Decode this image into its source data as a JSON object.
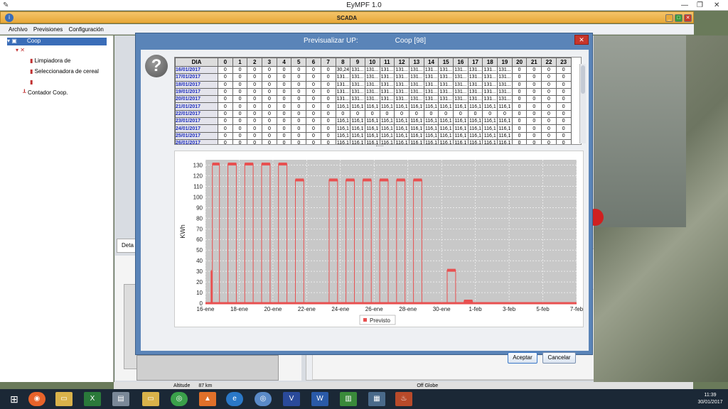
{
  "outer": {
    "app_title": "EyMPF 1.0"
  },
  "scada": {
    "title": "SCADA"
  },
  "menu": [
    "Archivo",
    "Previsiones",
    "Configuración"
  ],
  "tree": {
    "root": "Coop",
    "items": [
      "Limpiadora de",
      "Seleccionadora de cereal",
      "Contador Coop."
    ]
  },
  "lower_tab": "Deta",
  "status": {
    "altitude": "Altitude",
    "km": "87 km",
    "globe": "Off Globe"
  },
  "dialog": {
    "title": "Previsualizar UP:",
    "title_suffix": "Coop [98]",
    "accept": "Aceptar",
    "cancel": "Cancelar",
    "table": {
      "headers": [
        "DIA",
        "0",
        "1",
        "2",
        "3",
        "4",
        "5",
        "6",
        "7",
        "8",
        "9",
        "10",
        "11",
        "12",
        "13",
        "14",
        "15",
        "16",
        "17",
        "18",
        "19",
        "20",
        "21",
        "22",
        "23"
      ],
      "rows": [
        [
          "16/01/2017",
          "0",
          "0",
          "0",
          "0",
          "0",
          "0",
          "0",
          "0",
          "30,24",
          "131...",
          "131...",
          "131...",
          "131...",
          "131...",
          "131...",
          "131...",
          "131...",
          "131...",
          "131...",
          "131...",
          "0",
          "0",
          "0",
          "0"
        ],
        [
          "17/01/2017",
          "0",
          "0",
          "0",
          "0",
          "0",
          "0",
          "0",
          "0",
          "131...",
          "131...",
          "131...",
          "131...",
          "131...",
          "131...",
          "131...",
          "131...",
          "131...",
          "131...",
          "131...",
          "131...",
          "0",
          "0",
          "0",
          "0"
        ],
        [
          "18/01/2017",
          "0",
          "0",
          "0",
          "0",
          "0",
          "0",
          "0",
          "0",
          "131...",
          "131...",
          "131...",
          "131...",
          "131...",
          "131...",
          "131...",
          "131...",
          "131...",
          "131...",
          "131...",
          "131...",
          "0",
          "0",
          "0",
          "0"
        ],
        [
          "19/01/2017",
          "0",
          "0",
          "0",
          "0",
          "0",
          "0",
          "0",
          "0",
          "131...",
          "131...",
          "131...",
          "131...",
          "131...",
          "131...",
          "131...",
          "131...",
          "131...",
          "131...",
          "131...",
          "131...",
          "0",
          "0",
          "0",
          "0"
        ],
        [
          "20/01/2017",
          "0",
          "0",
          "0",
          "0",
          "0",
          "0",
          "0",
          "0",
          "131...",
          "131...",
          "131...",
          "131...",
          "131...",
          "131...",
          "131...",
          "131...",
          "131...",
          "131...",
          "131...",
          "131...",
          "0",
          "0",
          "0",
          "0"
        ],
        [
          "21/01/2017",
          "0",
          "0",
          "0",
          "0",
          "0",
          "0",
          "0",
          "0",
          "116,1",
          "116,1",
          "116,1",
          "116,1",
          "116,1",
          "116,1",
          "116,1",
          "116,1",
          "116,1",
          "116,1",
          "116,1",
          "116,1",
          "0",
          "0",
          "0",
          "0"
        ],
        [
          "22/01/2017",
          "0",
          "0",
          "0",
          "0",
          "0",
          "0",
          "0",
          "0",
          "0",
          "0",
          "0",
          "0",
          "0",
          "0",
          "0",
          "0",
          "0",
          "0",
          "0",
          "0",
          "0",
          "0",
          "0",
          "0"
        ],
        [
          "23/01/2017",
          "0",
          "0",
          "0",
          "0",
          "0",
          "0",
          "0",
          "0",
          "116,1",
          "116,1",
          "116,1",
          "116,1",
          "116,1",
          "116,1",
          "116,1",
          "116,1",
          "116,1",
          "116,1",
          "116,1",
          "116,1",
          "0",
          "0",
          "0",
          "0"
        ],
        [
          "24/01/2017",
          "0",
          "0",
          "0",
          "0",
          "0",
          "0",
          "0",
          "0",
          "116,1",
          "116,1",
          "116,1",
          "116,1",
          "116,1",
          "116,1",
          "116,1",
          "116,1",
          "116,1",
          "116,1",
          "116,1",
          "116,1",
          "0",
          "0",
          "0",
          "0"
        ],
        [
          "25/01/2017",
          "0",
          "0",
          "0",
          "0",
          "0",
          "0",
          "0",
          "0",
          "116,1",
          "116,1",
          "116,1",
          "116,1",
          "116,1",
          "116,1",
          "116,1",
          "116,1",
          "116,1",
          "116,1",
          "116,1",
          "116,1",
          "0",
          "0",
          "0",
          "0"
        ],
        [
          "26/01/2017",
          "0",
          "0",
          "0",
          "0",
          "0",
          "0",
          "0",
          "0",
          "116,1",
          "116,1",
          "116,1",
          "116,1",
          "116,1",
          "116,1",
          "116,1",
          "116,1",
          "116,1",
          "116,1",
          "116,1",
          "116,1",
          "0",
          "0",
          "0",
          "0"
        ]
      ]
    }
  },
  "taskbar": {
    "time": "11:39",
    "date": "30/01/2017"
  },
  "colors": {
    "series": "#e85050",
    "plot_bg": "#c8c8c8",
    "dialog": "#5a84b8"
  },
  "chart_data": {
    "type": "line",
    "ylabel": "KWh",
    "ylim": [
      0,
      135
    ],
    "yticks": [
      0,
      10,
      20,
      30,
      40,
      50,
      60,
      70,
      80,
      90,
      100,
      110,
      120,
      130
    ],
    "xlim": [
      0,
      22
    ],
    "xticks": [
      {
        "v": 0,
        "label": "16-ene"
      },
      {
        "v": 2,
        "label": "18-ene"
      },
      {
        "v": 4,
        "label": "20-ene"
      },
      {
        "v": 6,
        "label": "22-ene"
      },
      {
        "v": 8,
        "label": "24-ene"
      },
      {
        "v": 10,
        "label": "26-ene"
      },
      {
        "v": 12,
        "label": "28-ene"
      },
      {
        "v": 14,
        "label": "30-ene"
      },
      {
        "v": 16,
        "label": "1-feb"
      },
      {
        "v": 18,
        "label": "3-feb"
      },
      {
        "v": 20,
        "label": "5-feb"
      },
      {
        "v": 22,
        "label": "7-feb"
      }
    ],
    "grid": true,
    "legend": "bottom",
    "series": [
      {
        "name": "Previsto",
        "days": [
          {
            "start": "16-ene",
            "x0": 0.33,
            "x1": 0.83,
            "value": 131,
            "first": 30
          },
          {
            "start": "17-ene",
            "x0": 1.33,
            "x1": 1.83,
            "value": 131
          },
          {
            "start": "18-ene",
            "x0": 2.33,
            "x1": 2.83,
            "value": 131
          },
          {
            "start": "19-ene",
            "x0": 3.33,
            "x1": 3.83,
            "value": 131
          },
          {
            "start": "20-ene",
            "x0": 4.33,
            "x1": 4.83,
            "value": 131
          },
          {
            "start": "21-ene",
            "x0": 5.33,
            "x1": 5.83,
            "value": 116
          },
          {
            "start": "23-ene",
            "x0": 7.33,
            "x1": 7.83,
            "value": 116
          },
          {
            "start": "24-ene",
            "x0": 8.33,
            "x1": 8.83,
            "value": 116
          },
          {
            "start": "25-ene",
            "x0": 9.33,
            "x1": 9.83,
            "value": 116
          },
          {
            "start": "26-ene",
            "x0": 10.33,
            "x1": 10.83,
            "value": 116
          },
          {
            "start": "27-ene",
            "x0": 11.33,
            "x1": 11.83,
            "value": 116
          },
          {
            "start": "28-ene",
            "x0": 12.33,
            "x1": 12.83,
            "value": 116
          },
          {
            "start": "30-ene",
            "x0": 14.33,
            "x1": 14.83,
            "value": 31
          },
          {
            "start": "31-ene",
            "x0": 15.33,
            "x1": 15.83,
            "value": 2
          }
        ]
      }
    ]
  }
}
